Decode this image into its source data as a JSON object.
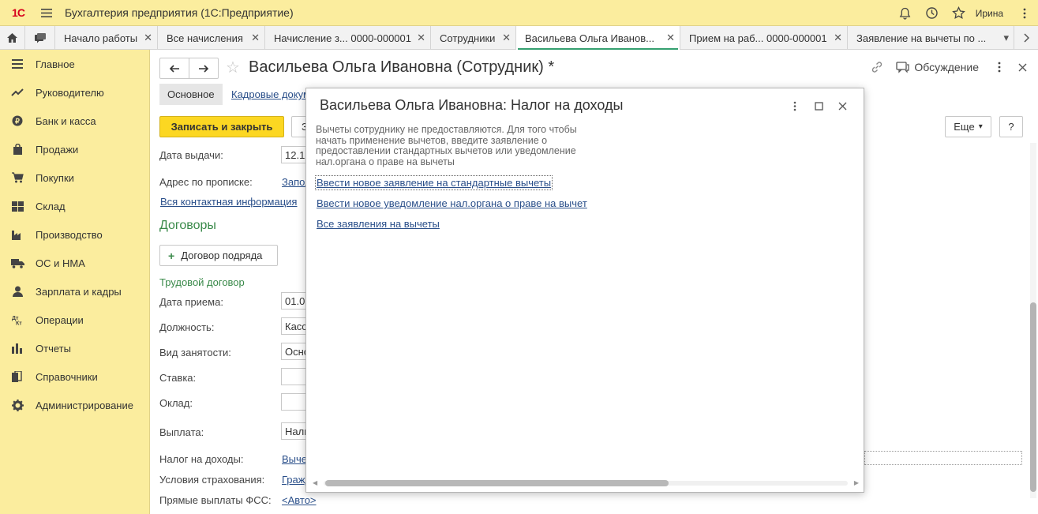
{
  "app": {
    "title": "Бухгалтерия предприятия  (1С:Предприятие)",
    "logo": "1С",
    "user": "Ирина"
  },
  "tabs": [
    {
      "label": "Начало работы"
    },
    {
      "label": "Все начисления"
    },
    {
      "label": "Начисление з...  0000-000001"
    },
    {
      "label": "Сотрудники"
    },
    {
      "label": "Васильева Ольга Иванов..."
    },
    {
      "label": "Прием на раб...  0000-000001"
    },
    {
      "label": "Заявление на вычеты по ..."
    }
  ],
  "sidebar": {
    "items": [
      {
        "label": "Главное",
        "icon": "menu-lines-icon"
      },
      {
        "label": "Руководителю",
        "icon": "trend-icon"
      },
      {
        "label": "Банк и касса",
        "icon": "coin-icon"
      },
      {
        "label": "Продажи",
        "icon": "bag-icon"
      },
      {
        "label": "Покупки",
        "icon": "cart-icon"
      },
      {
        "label": "Склад",
        "icon": "grid-icon"
      },
      {
        "label": "Производство",
        "icon": "factory-icon"
      },
      {
        "label": "ОС и НМА",
        "icon": "truck-icon"
      },
      {
        "label": "Зарплата и кадры",
        "icon": "person-icon"
      },
      {
        "label": "Операции",
        "icon": "dt-kt-icon"
      },
      {
        "label": "Отчеты",
        "icon": "bars-icon"
      },
      {
        "label": "Справочники",
        "icon": "books-icon"
      },
      {
        "label": "Администрирование",
        "icon": "gear-icon"
      }
    ]
  },
  "form": {
    "title": "Васильева Ольга Ивановна (Сотрудник) *",
    "discussion": "Обсуждение",
    "tab_main": "Основное",
    "tab_hr": "Кадровые документы",
    "save_close": "Записать и закрыть",
    "save_short": "Записать",
    "more": "Еще",
    "help": "?",
    "issue_date_label": "Дата выдачи:",
    "issue_date_value": "12.12.2010",
    "address_label": "Адрес по прописке:",
    "address_value": "Заполнить",
    "contacts_link": "Вся контактная информация",
    "contracts_title": "Договоры",
    "contract_button": "Договор подряда",
    "employment_title": "Трудовой договор",
    "hire_date_label": "Дата приема:",
    "hire_date_value": "01.01.2021",
    "position_label": "Должность:",
    "position_value": "Кассир",
    "employment_type_label": "Вид занятости:",
    "employment_type_value": "Основное место работы",
    "rate_label": "Ставка:",
    "rate_value": "",
    "salary_label": "Оклад:",
    "salary_value": "",
    "payment_label": "Выплата:",
    "payment_value": "Наличными",
    "tax_label": "Налог на доходы:",
    "tax_value": "Вычеты не предоставляются",
    "insurance_label": "Условия страхования:",
    "insurance_value": "Гражданин РФ",
    "fss_label": "Прямые выплаты ФСС:",
    "fss_value": "<Авто>"
  },
  "modal": {
    "title": "Васильева Ольга Ивановна: Налог на доходы",
    "message": "Вычеты сотруднику не предоставляются. Для того чтобы начать применение вычетов, введите заявление о предоставлении стандартных вычетов или уведомление нал.органа о праве на вычеты",
    "link_standard": "Ввести новое заявление на стандартные вычеты",
    "link_notice": "Ввести новое уведомление нал.органа о праве на вычет",
    "link_all": "Все заявления на вычеты"
  },
  "colors": {
    "accent_yellow": "#fcd722",
    "sidebar_bg": "#fbed9e",
    "link": "#2a4f8a",
    "group_green": "#3a8a4a"
  }
}
